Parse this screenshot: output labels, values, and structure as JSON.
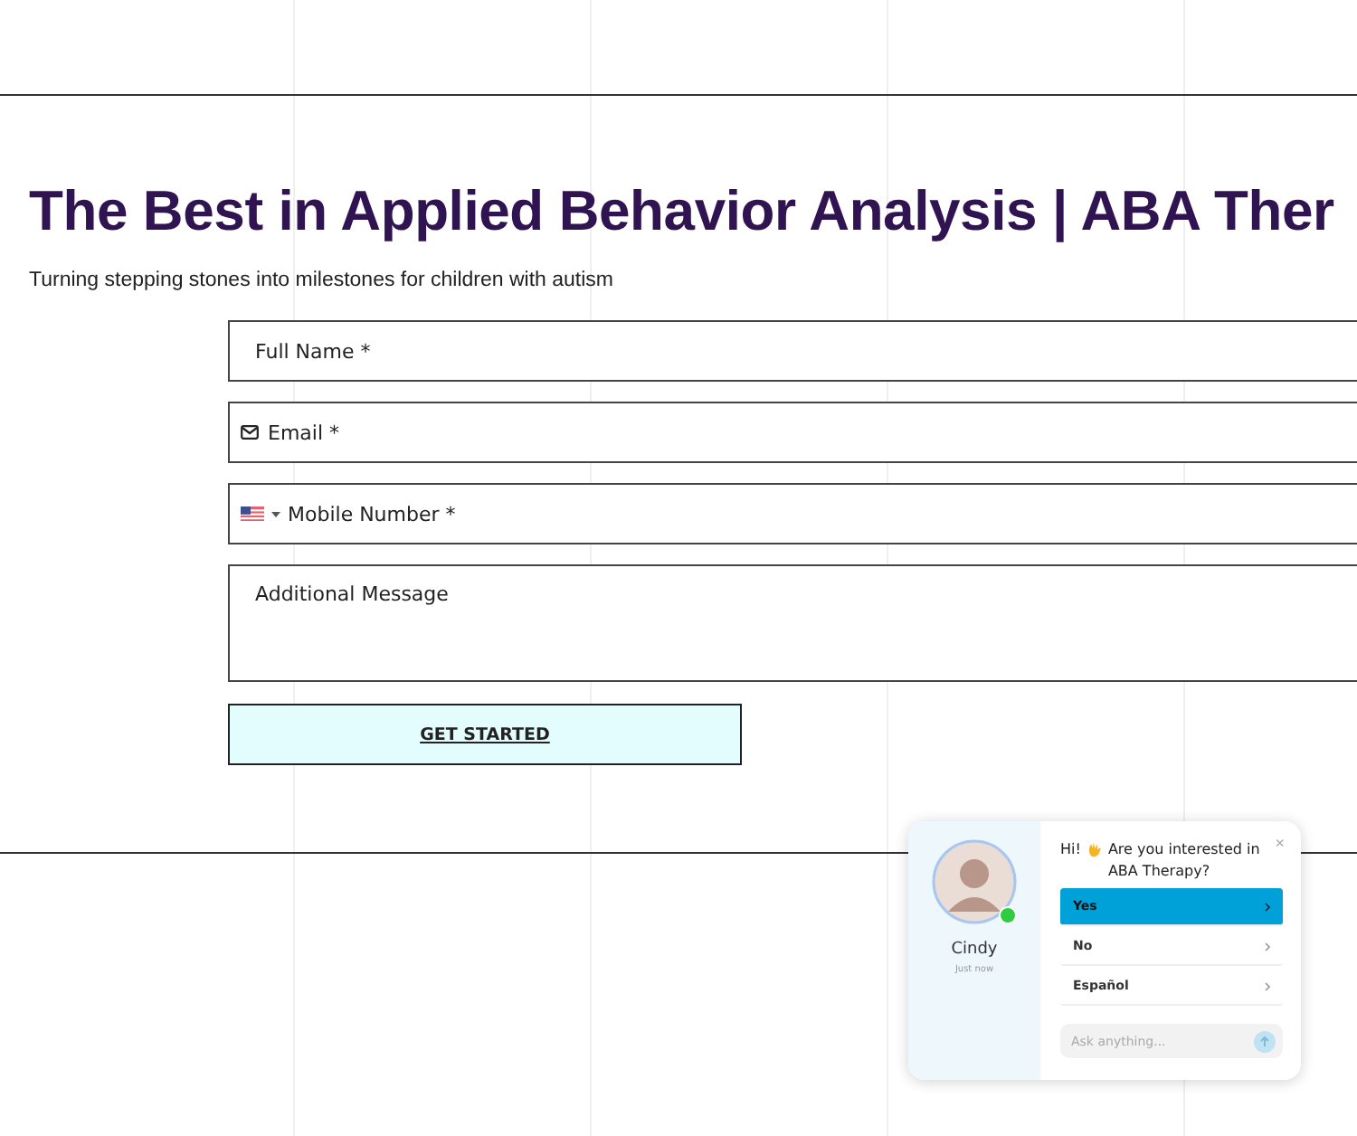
{
  "header": {
    "title": "The Best in Applied Behavior Analysis | ABA Ther",
    "subtitle": "Turning stepping stones into milestones for children with autism"
  },
  "form": {
    "fields": [
      {
        "kind": "text",
        "placeholder": "Full Name *"
      },
      {
        "kind": "email",
        "placeholder": "Email *"
      },
      {
        "kind": "phone",
        "placeholder": "Mobile Number *"
      },
      {
        "kind": "textarea",
        "placeholder": "Additional Message"
      }
    ],
    "submit": "GET STARTED"
  },
  "chat": {
    "agent": {
      "name": "Cindy",
      "time": "Just now",
      "online": true
    },
    "close": "×",
    "greeting": "Hi!",
    "question": "Are you interested in ABA Therapy?",
    "options": [
      {
        "label": "Yes",
        "selected": true
      },
      {
        "label": "No",
        "selected": false
      },
      {
        "label": "Español",
        "selected": false
      }
    ],
    "input": {
      "placeholder": "Ask anything..."
    }
  }
}
